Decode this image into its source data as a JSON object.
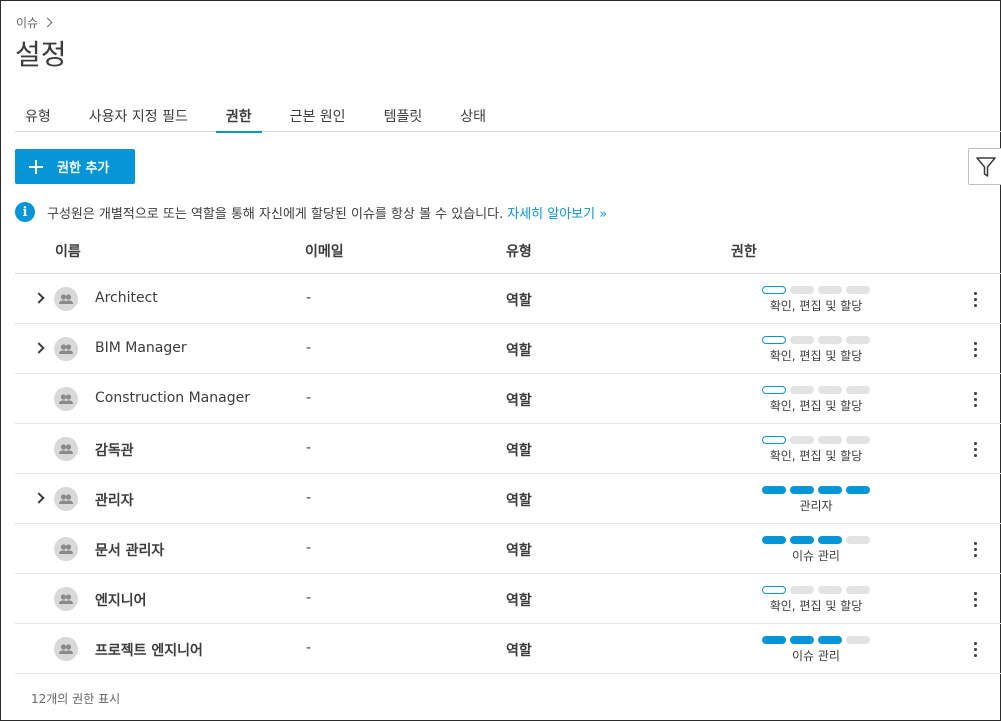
{
  "breadcrumb": "이슈",
  "title": "설정",
  "tabs": [
    {
      "label": "유형",
      "active": false
    },
    {
      "label": "사용자 지정 필드",
      "active": false
    },
    {
      "label": "권한",
      "active": true
    },
    {
      "label": "근본 원인",
      "active": false
    },
    {
      "label": "템플릿",
      "active": false
    },
    {
      "label": "상태",
      "active": false
    }
  ],
  "add_button": "권한 추가",
  "info": {
    "text": "구성원은 개별적으로 또는 역할을 통해 자신에게 할당된 이슈를 항상 볼 수 있습니다.",
    "link": "자세히 알아보기 »"
  },
  "columns": {
    "name": "이름",
    "email": "이메일",
    "type": "유형",
    "permission": "권한"
  },
  "rows": [
    {
      "name": "Architect",
      "email": "-",
      "type": "역할",
      "permission": "확인, 편집 및 할당",
      "level": "outline-1",
      "expandable": true,
      "more": true
    },
    {
      "name": "BIM Manager",
      "email": "-",
      "type": "역할",
      "permission": "확인, 편집 및 할당",
      "level": "outline-1",
      "expandable": true,
      "more": true
    },
    {
      "name": "Construction Manager",
      "email": "-",
      "type": "역할",
      "permission": "확인, 편집 및 할당",
      "level": "outline-1",
      "expandable": false,
      "more": true
    },
    {
      "name": "감독관",
      "email": "-",
      "type": "역할",
      "permission": "확인, 편집 및 할당",
      "level": "outline-1",
      "expandable": false,
      "more": true
    },
    {
      "name": "관리자",
      "email": "-",
      "type": "역할",
      "permission": "관리자",
      "level": "fill-4",
      "expandable": true,
      "more": false
    },
    {
      "name": "문서 관리자",
      "email": "-",
      "type": "역할",
      "permission": "이슈 관리",
      "level": "fill-3",
      "expandable": false,
      "more": true
    },
    {
      "name": "엔지니어",
      "email": "-",
      "type": "역할",
      "permission": "확인, 편집 및 할당",
      "level": "outline-1",
      "expandable": false,
      "more": true
    },
    {
      "name": "프로젝트 엔지니어",
      "email": "-",
      "type": "역할",
      "permission": "이슈 관리",
      "level": "fill-3",
      "expandable": false,
      "more": true
    }
  ],
  "footer": "12개의 권한 표시",
  "colors": {
    "accent": "#0696d7",
    "pill_empty": "#e3e3e3"
  },
  "icons": {
    "add": "plus-icon",
    "filter": "filter-icon",
    "info": "info-icon",
    "avatar": "group-avatar-icon",
    "more": "more-vertical-icon",
    "expand": "chevron-right-icon"
  }
}
